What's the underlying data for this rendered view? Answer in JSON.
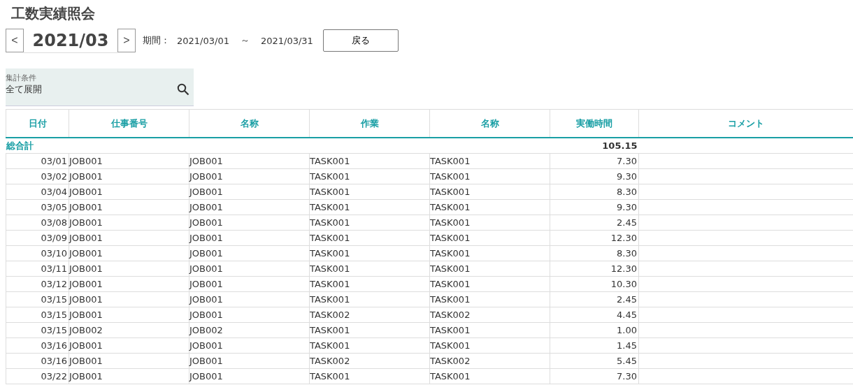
{
  "title": "工数実績照会",
  "period_nav": {
    "month": "2021/03",
    "prev": "<",
    "next": ">"
  },
  "period": {
    "label": "期間：",
    "from": "2021/03/01",
    "separator": "～",
    "to": "2021/03/31"
  },
  "back_button": "戻る",
  "condition": {
    "label": "集計条件",
    "value": "全て展開"
  },
  "table": {
    "columns": [
      "日付",
      "仕事番号",
      "名称",
      "作業",
      "名称",
      "実働時間",
      "コメント"
    ],
    "total": {
      "label": "総合計",
      "hours": "105.15"
    },
    "rows": [
      [
        "03/01",
        "JOB001",
        "JOB001",
        "TASK001",
        "TASK001",
        "7.30"
      ],
      [
        "03/02",
        "JOB001",
        "JOB001",
        "TASK001",
        "TASK001",
        "9.30"
      ],
      [
        "03/04",
        "JOB001",
        "JOB001",
        "TASK001",
        "TASK001",
        "8.30"
      ],
      [
        "03/05",
        "JOB001",
        "JOB001",
        "TASK001",
        "TASK001",
        "9.30"
      ],
      [
        "03/08",
        "JOB001",
        "JOB001",
        "TASK001",
        "TASK001",
        "2.45"
      ],
      [
        "03/09",
        "JOB001",
        "JOB001",
        "TASK001",
        "TASK001",
        "12.30"
      ],
      [
        "03/10",
        "JOB001",
        "JOB001",
        "TASK001",
        "TASK001",
        "8.30"
      ],
      [
        "03/11",
        "JOB001",
        "JOB001",
        "TASK001",
        "TASK001",
        "12.30"
      ],
      [
        "03/12",
        "JOB001",
        "JOB001",
        "TASK001",
        "TASK001",
        "10.30"
      ],
      [
        "03/15",
        "JOB001",
        "JOB001",
        "TASK001",
        "TASK001",
        "2.45"
      ],
      [
        "03/15",
        "JOB001",
        "JOB001",
        "TASK002",
        "TASK002",
        "4.45"
      ],
      [
        "03/15",
        "JOB002",
        "JOB002",
        "TASK001",
        "TASK001",
        "1.00"
      ],
      [
        "03/16",
        "JOB001",
        "JOB001",
        "TASK001",
        "TASK001",
        "1.45"
      ],
      [
        "03/16",
        "JOB001",
        "JOB001",
        "TASK002",
        "TASK002",
        "5.45"
      ],
      [
        "03/22",
        "JOB001",
        "JOB001",
        "TASK001",
        "TASK001",
        "7.30"
      ]
    ]
  }
}
